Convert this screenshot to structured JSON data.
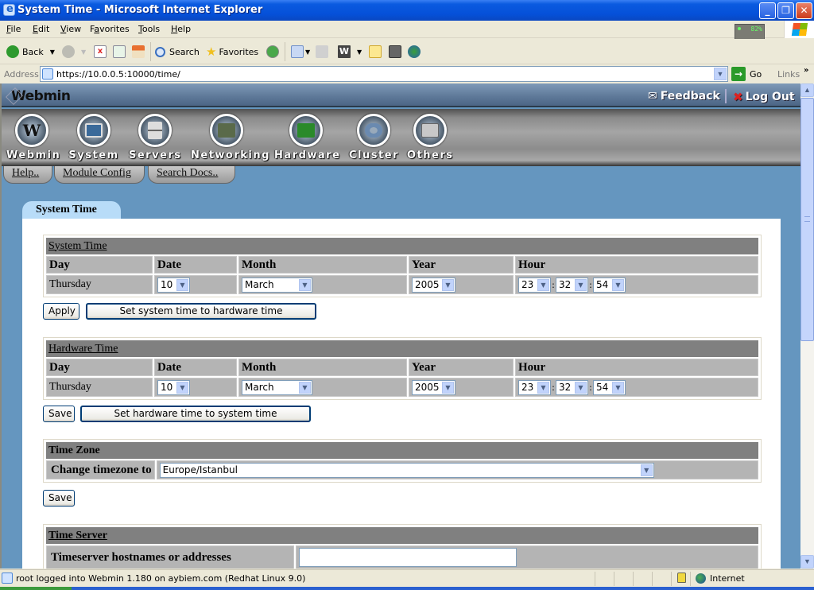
{
  "window": {
    "title": "System Time - Microsoft Internet Explorer",
    "controls": {
      "minimize": "_",
      "restore": "❐",
      "close": "✕"
    }
  },
  "menu": [
    "File",
    "Edit",
    "View",
    "Favorites",
    "Tools",
    "Help"
  ],
  "menu_accels": [
    "F",
    "E",
    "V",
    "a",
    "T",
    "H"
  ],
  "net_monitor": {
    "percent": "82%"
  },
  "toolbar": {
    "back": "Back",
    "search": "Search",
    "favorites": "Favorites",
    "icons": [
      "back-icon",
      "forward-icon",
      "stop-icon",
      "refresh-icon",
      "home-icon",
      "search-icon",
      "favorites-icon",
      "history-icon",
      "mail-icon",
      "print-icon",
      "edit-icon",
      "note-icon",
      "research-icon",
      "messenger-icon"
    ]
  },
  "address_bar": {
    "label": "Address",
    "url": "https://10.0.0.5:10000/time/",
    "go": "Go",
    "links": "Links",
    "more": "»"
  },
  "webmin": {
    "logo": "Webmin",
    "feedback": "Feedback",
    "logout": "Log Out",
    "nav": [
      {
        "label": "Webmin",
        "icon": "webmin-icon"
      },
      {
        "label": "System",
        "icon": "system-icon"
      },
      {
        "label": "Servers",
        "icon": "servers-icon"
      },
      {
        "label": "Networking",
        "icon": "networking-icon"
      },
      {
        "label": "Hardware",
        "icon": "hardware-icon"
      },
      {
        "label": "Cluster",
        "icon": "cluster-icon"
      },
      {
        "label": "Others",
        "icon": "others-icon"
      }
    ],
    "subtabs": [
      "Help..",
      "Module Config",
      "Search Docs.."
    ]
  },
  "page": {
    "tab": "System Time",
    "columns": [
      "Day",
      "Date",
      "Month",
      "Year",
      "Hour"
    ],
    "system_time": {
      "title": "System Time",
      "day": "Thursday",
      "date": "10",
      "month": "March",
      "year": "2005",
      "hour": "23",
      "minute": "32",
      "second": "54",
      "apply": "Apply",
      "sync": "Set system time to hardware time"
    },
    "hardware_time": {
      "title": "Hardware Time",
      "day": "Thursday",
      "date": "10",
      "month": "March",
      "year": "2005",
      "hour": "23",
      "minute": "32",
      "second": "54",
      "save": "Save",
      "sync": "Set hardware time to system time"
    },
    "time_zone": {
      "title": "Time Zone",
      "label": "Change timezone to",
      "value": "Europe/Istanbul",
      "save": "Save"
    },
    "time_server": {
      "title": "Time Server",
      "label": "Timeserver hostnames or addresses",
      "value": ""
    }
  },
  "status_bar": {
    "text": "root logged into Webmin 1.180 on aybiem.com (Redhat Linux 9.0)",
    "zone": "Internet"
  }
}
